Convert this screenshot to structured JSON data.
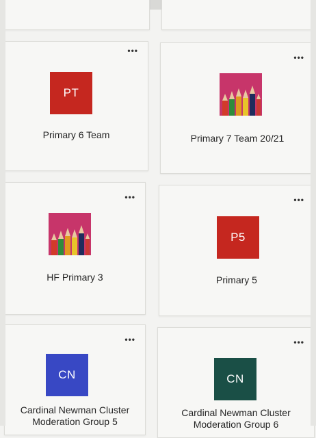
{
  "teams": [
    {
      "id": "primary-6",
      "initials": "PT",
      "name": "Primary 6 Team",
      "avatar_type": "initials",
      "color": "#c5271f"
    },
    {
      "id": "primary-7",
      "initials": "",
      "name": "Primary 7 Team 20/21",
      "avatar_type": "pencils",
      "color": "#c7356a"
    },
    {
      "id": "hf-primary-3",
      "initials": "",
      "name": "HF Primary 3",
      "avatar_type": "pencils",
      "color": "#c7356a"
    },
    {
      "id": "primary-5",
      "initials": "P5",
      "name": "Primary 5",
      "avatar_type": "initials",
      "color": "#c5271f"
    },
    {
      "id": "cardinal-5",
      "initials": "CN",
      "name": "Cardinal Newman Cluster Moderation Group 5",
      "avatar_type": "initials",
      "color": "#3848c4"
    },
    {
      "id": "cardinal-6",
      "initials": "CN",
      "name": "Cardinal Newman Cluster Moderation Group 6",
      "avatar_type": "initials",
      "color": "#1a4f46"
    }
  ],
  "more_options_label": "•••"
}
